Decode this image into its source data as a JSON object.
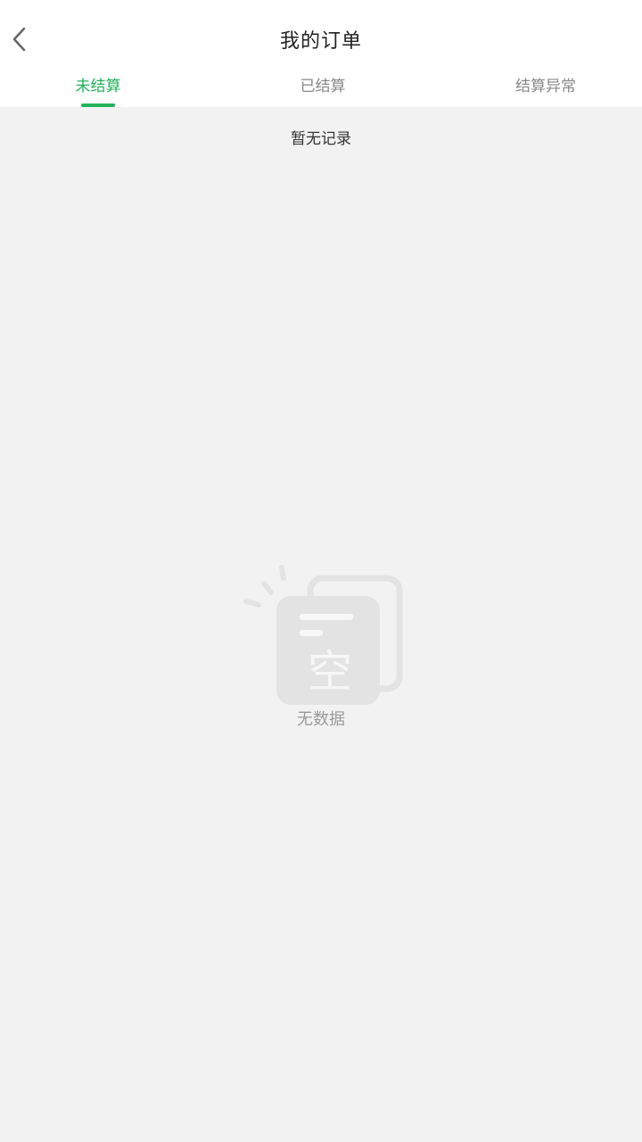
{
  "header": {
    "title": "我的订单",
    "back_icon": "chevron-left-icon"
  },
  "tabs": [
    {
      "label": "未结算",
      "active": true
    },
    {
      "label": "已结算",
      "active": false
    },
    {
      "label": "结算异常",
      "active": false
    }
  ],
  "notice": "暂无记录",
  "empty_state": {
    "illustration_char": "空",
    "text": "无数据",
    "icon": "empty-box-icon"
  },
  "colors": {
    "accent": "#22b25a",
    "background": "#f2f2f2",
    "tab_inactive": "#888888"
  }
}
